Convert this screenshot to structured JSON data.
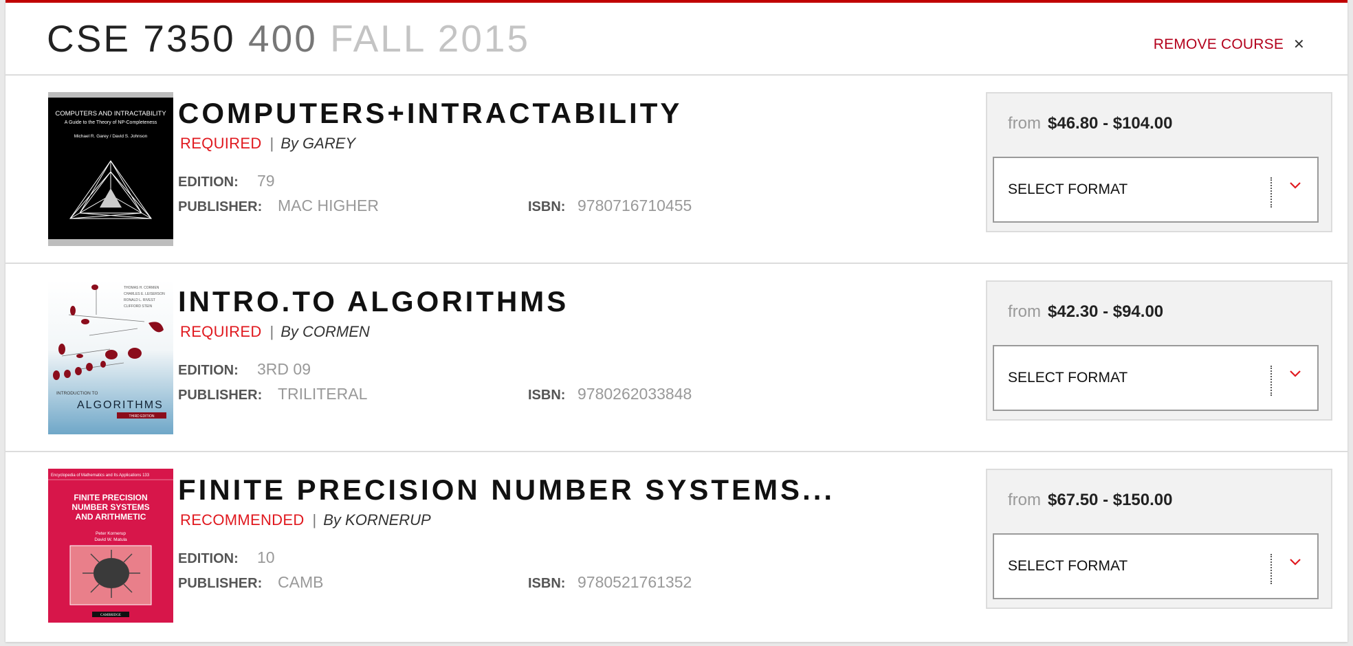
{
  "course": {
    "dept_number": "CSE 7350",
    "section": "400",
    "term": "FALL 2015",
    "remove_label": "REMOVE COURSE",
    "remove_icon": "close-icon",
    "accent_color": "#c00000"
  },
  "books": [
    {
      "title": "COMPUTERS+INTRACTABILITY",
      "requirement": "REQUIRED",
      "author": "By GAREY",
      "edition_label": "EDITION:",
      "edition": "79",
      "publisher_label": "PUBLISHER:",
      "publisher": "MAC HIGHER",
      "isbn_label": "ISBN:",
      "isbn": "9780716710455",
      "price_from": "from",
      "price_range": "$46.80 - $104.00",
      "format_label": "SELECT FORMAT",
      "cover": {
        "line1": "COMPUTERS AND INTRACTABILITY",
        "line2": "A Guide to the Theory of NP-Completeness",
        "authors": "Michael R. Garey  /  David S. Johnson"
      }
    },
    {
      "title": "INTRO.TO ALGORITHMS",
      "requirement": "REQUIRED",
      "author": "By CORMEN",
      "edition_label": "EDITION:",
      "edition": "3RD 09",
      "publisher_label": "PUBLISHER:",
      "publisher": "TRILITERAL",
      "isbn_label": "ISBN:",
      "isbn": "9780262033848",
      "price_from": "from",
      "price_range": "$42.30 - $94.00",
      "format_label": "SELECT FORMAT",
      "cover": {
        "authors": [
          "THOMAS H. CORMEN",
          "CHARLES E. LEISERSON",
          "RONALD L. RIVEST",
          "CLIFFORD STEIN"
        ],
        "intro": "INTRODUCTION TO",
        "title": "ALGORITHMS",
        "edition": "THIRD EDITION"
      }
    },
    {
      "title": "FINITE PRECISION NUMBER SYSTEMS...",
      "requirement": "RECOMMENDED",
      "author": "By KORNERUP",
      "edition_label": "EDITION:",
      "edition": "10",
      "publisher_label": "PUBLISHER:",
      "publisher": "CAMB",
      "isbn_label": "ISBN:",
      "isbn": "9780521761352",
      "price_from": "from",
      "price_range": "$67.50 - $150.00",
      "format_label": "SELECT FORMAT",
      "cover": {
        "series": "Encyclopedia of Mathematics and Its Applications 133",
        "title_lines": [
          "FINITE PRECISION",
          "NUMBER SYSTEMS",
          "AND ARITHMETIC"
        ],
        "authors": [
          "Peter Kornerup",
          "David W. Matula"
        ],
        "publisher": "CAMBRIDGE"
      }
    }
  ]
}
